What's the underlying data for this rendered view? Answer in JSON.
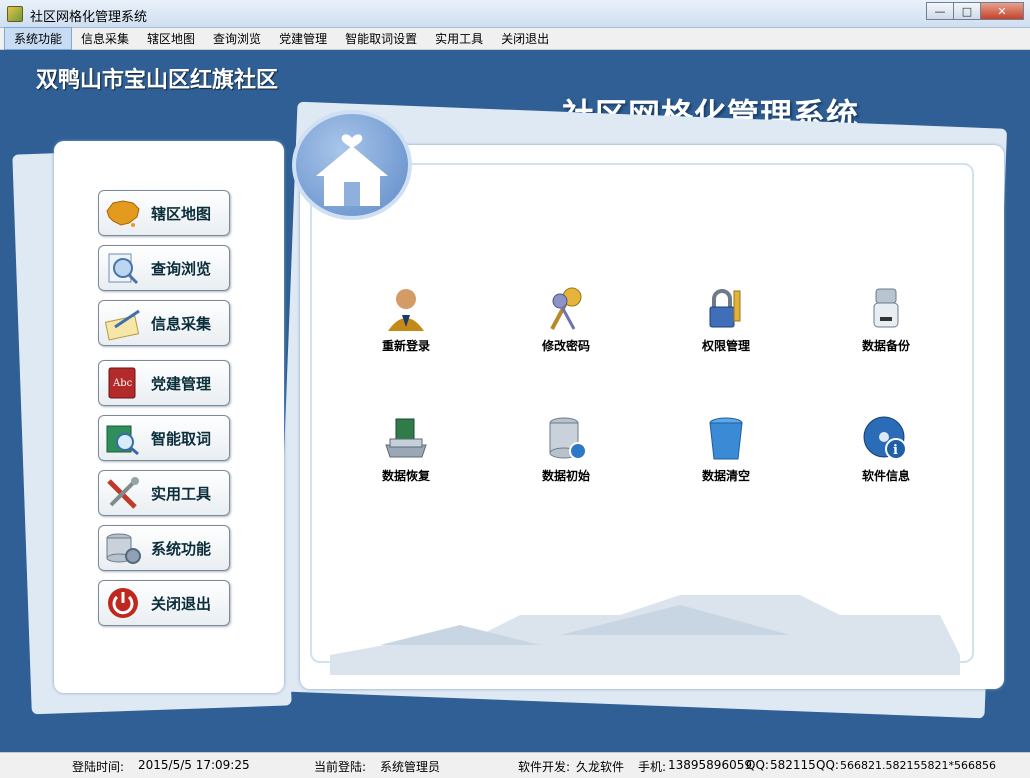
{
  "window": {
    "title": "社区网格化管理系统",
    "buttons": {
      "minimize": "—",
      "maximize": "□",
      "close": "✕"
    }
  },
  "menu": [
    {
      "label": "系统功能",
      "active": true
    },
    {
      "label": "信息采集"
    },
    {
      "label": "辖区地图"
    },
    {
      "label": "查询浏览"
    },
    {
      "label": "党建管理"
    },
    {
      "label": "智能取词设置"
    },
    {
      "label": "实用工具"
    },
    {
      "label": "关闭退出"
    }
  ],
  "header": {
    "community": "双鸭山市宝山区红旗社区",
    "system_title": "社区网格化管理系统"
  },
  "nav": [
    {
      "label": "辖区地图",
      "icon": "china-map-icon"
    },
    {
      "label": "查询浏览",
      "icon": "magnifier-document-icon"
    },
    {
      "label": "信息采集",
      "icon": "notepad-pen-icon"
    },
    {
      "label": "党建管理",
      "icon": "abc-book-icon"
    },
    {
      "label": "智能取词",
      "icon": "book-magnifier-icon"
    },
    {
      "label": "实用工具",
      "icon": "tools-icon"
    },
    {
      "label": "系统功能",
      "icon": "database-gear-icon"
    },
    {
      "label": "关闭退出",
      "icon": "power-icon"
    }
  ],
  "functions": [
    {
      "label": "重新登录",
      "icon": "user-icon"
    },
    {
      "label": "修改密码",
      "icon": "keys-icon"
    },
    {
      "label": "权限管理",
      "icon": "padlock-key-icon"
    },
    {
      "label": "数据备份",
      "icon": "usb-drive-icon"
    },
    {
      "label": "数据恢复",
      "icon": "disk-drive-icon"
    },
    {
      "label": "数据初始",
      "icon": "database-refresh-icon"
    },
    {
      "label": "数据清空",
      "icon": "trash-can-icon"
    },
    {
      "label": "软件信息",
      "icon": "info-disc-icon"
    }
  ],
  "status": {
    "login_time_label": "登陆时间:",
    "login_time": "2015/5/5 17:09:25",
    "current_user_label": "当前登陆:",
    "current_user": "系统管理员",
    "developer_label": "软件开发:",
    "developer": "久龙软件",
    "phone_label": "手机:",
    "phone": "13895896059",
    "qq1_label": "QQ:",
    "qq1": "582115",
    "qq2_label": "QQ:",
    "qq2": "566821.582155821*566856"
  },
  "colors": {
    "background": "#2f5f94",
    "panel": "#ffffff",
    "menu_active": "#c8ddf3"
  }
}
